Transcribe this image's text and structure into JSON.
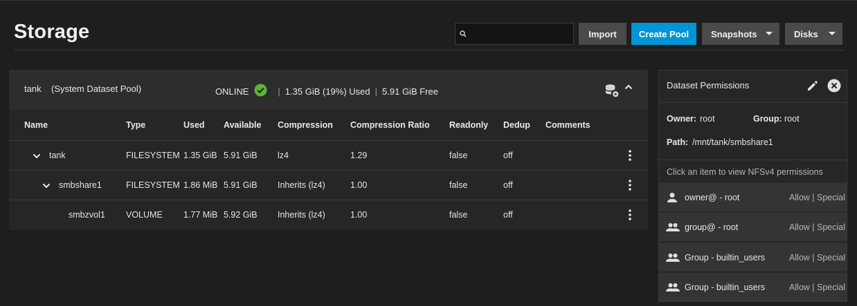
{
  "page": {
    "title": "Storage"
  },
  "toolbar": {
    "search_placeholder": "",
    "import_label": "Import",
    "create_pool_label": "Create Pool",
    "snapshots_label": "Snapshots",
    "disks_label": "Disks"
  },
  "pool": {
    "name": "tank",
    "subtitle": "(System Dataset Pool)",
    "status": "ONLINE",
    "used": "1.35 GiB (19%) Used",
    "free": "5.91 GiB Free",
    "separator": "|"
  },
  "table": {
    "headers": {
      "name": "Name",
      "type": "Type",
      "used": "Used",
      "available": "Available",
      "compression": "Compression",
      "ratio": "Compression Ratio",
      "readonly": "Readonly",
      "dedup": "Dedup",
      "comments": "Comments"
    },
    "rows": [
      {
        "name": "tank",
        "type": "FILESYSTEM",
        "used": "1.35 GiB",
        "available": "5.91 GiB",
        "compression": "lz4",
        "ratio": "1.29",
        "readonly": "false",
        "dedup": "off",
        "comments": ""
      },
      {
        "name": "smbshare1",
        "type": "FILESYSTEM",
        "used": "1.86 MiB",
        "available": "5.91 GiB",
        "compression": "Inherits (lz4)",
        "ratio": "1.00",
        "readonly": "false",
        "dedup": "off",
        "comments": ""
      },
      {
        "name": "smbzvol1",
        "type": "VOLUME",
        "used": "1.77 MiB",
        "available": "5.92 GiB",
        "compression": "Inherits (lz4)",
        "ratio": "1.00",
        "readonly": "false",
        "dedup": "off",
        "comments": ""
      }
    ]
  },
  "permissions": {
    "title": "Dataset Permissions",
    "owner_label": "Owner:",
    "owner": "root",
    "group_label": "Group:",
    "group": "root",
    "path_label": "Path:",
    "path": "/mnt/tank/smbshare1",
    "hint": "Click an item to view NFSv4 permissions",
    "aces": [
      {
        "icon": "person-icon",
        "name": "owner@ - root",
        "perm": "Allow | Special"
      },
      {
        "icon": "group-icon",
        "name": "group@ - root",
        "perm": "Allow | Special"
      },
      {
        "icon": "group-icon",
        "name": "Group - builtin_users",
        "perm": "Allow | Special"
      },
      {
        "icon": "group-icon",
        "name": "Group - builtin_users",
        "perm": "Allow | Special"
      }
    ]
  },
  "colors": {
    "accent": "#0095d5",
    "online": "#5ab534",
    "background": "#1e1e1e",
    "panel": "#262626"
  }
}
